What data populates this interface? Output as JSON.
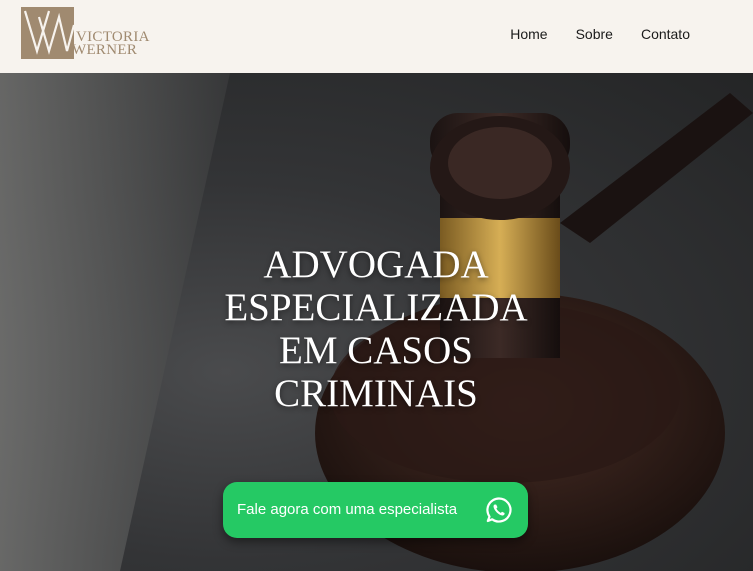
{
  "brand": {
    "monogram": "VW",
    "name_line1": "VICTORIA",
    "name_line2": "WERNER",
    "color": "#a08a70"
  },
  "nav": {
    "items": [
      {
        "label": "Home"
      },
      {
        "label": "Sobre"
      },
      {
        "label": "Contato"
      }
    ]
  },
  "hero": {
    "headline_lines": [
      "ADVOGADA",
      "ESPECIALIZADA",
      "EM CASOS",
      "CRIMINAIS"
    ],
    "cta_label": "Fale agora com uma especialista",
    "cta_icon": "whatsapp-icon",
    "cta_color": "#25c964"
  }
}
